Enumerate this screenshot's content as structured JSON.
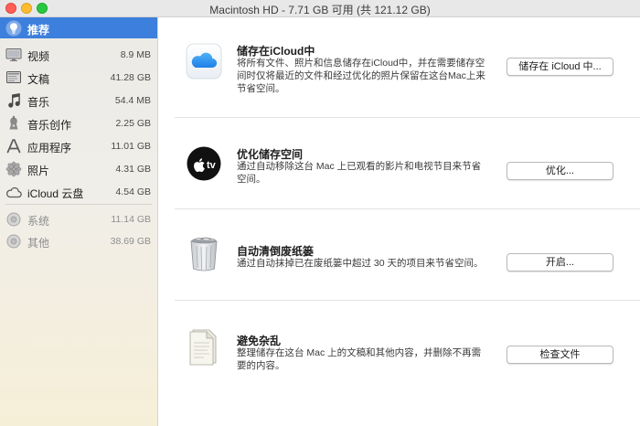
{
  "window": {
    "title": "Macintosh HD - 7.71 GB 可用 (共 121.12 GB)"
  },
  "sidebar": {
    "items": [
      {
        "label": "推荐",
        "size": "",
        "icon": "lightbulb-icon",
        "selected": true
      },
      {
        "label": "视频",
        "size": "8.9 MB",
        "icon": "monitor-icon"
      },
      {
        "label": "文稿",
        "size": "41.28 GB",
        "icon": "document-icon"
      },
      {
        "label": "音乐",
        "size": "54.4 MB",
        "icon": "music-note-icon"
      },
      {
        "label": "音乐创作",
        "size": "2.25 GB",
        "icon": "music-creation-icon"
      },
      {
        "label": "应用程序",
        "size": "11.01 GB",
        "icon": "app-store-icon"
      },
      {
        "label": "照片",
        "size": "4.31 GB",
        "icon": "photos-icon"
      },
      {
        "label": "iCloud 云盘",
        "size": "4.54 GB",
        "icon": "cloud-icon"
      },
      {
        "label": "系统",
        "size": "11.14 GB",
        "icon": "system-disc-icon",
        "muted": true
      },
      {
        "label": "其他",
        "size": "38.69 GB",
        "icon": "other-disc-icon",
        "muted": true
      }
    ]
  },
  "recommendations": [
    {
      "title": "储存在iCloud中",
      "description": "将所有文件、照片和信息储存在iCloud中，并在需要储存空间时仅将最近的文件和经过优化的照片保留在这台Mac上来节省空间。",
      "button": "储存在 iCloud 中...",
      "icon": "icloud-icon"
    },
    {
      "title": "优化储存空间",
      "description": "通过自动移除这台 Mac 上已观看的影片和电视节目来节省空间。",
      "button": "优化...",
      "icon": "apple-tv-icon",
      "icon_text": "tv"
    },
    {
      "title": "自动清倒废纸篓",
      "description": "通过自动抹掉已在废纸篓中超过 30 天的项目来节省空间。",
      "button": "开启...",
      "icon": "trash-icon"
    },
    {
      "title": "避免杂乱",
      "description": "整理储存在这台 Mac 上的文稿和其他内容，并删除不再需要的内容。",
      "button": "检查文件",
      "icon": "document-review-icon"
    }
  ],
  "colors": {
    "selection": "#3d7fdc",
    "accent_blue": "#2f8cf0"
  }
}
